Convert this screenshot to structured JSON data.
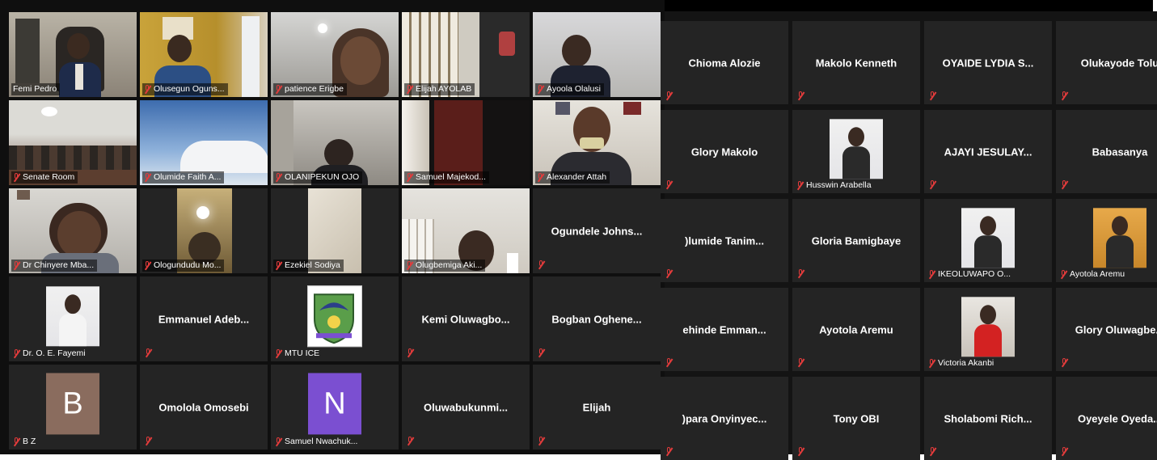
{
  "left_grid": {
    "tiles": [
      {
        "name": "Femi Pedro",
        "kind": "video",
        "active": true
      },
      {
        "name": "Olusegun Oguns...",
        "kind": "video"
      },
      {
        "name": "patience Erigbe",
        "kind": "video"
      },
      {
        "name": "Elijah AYOLAB",
        "kind": "video"
      },
      {
        "name": "Ayoola Olalusi",
        "kind": "video"
      },
      {
        "name": "Senate Room",
        "kind": "video"
      },
      {
        "name": "Olumide Faith A...",
        "kind": "video"
      },
      {
        "name": "OLANIPEKUN OJO",
        "kind": "video"
      },
      {
        "name": "Samuel Majekod...",
        "kind": "video"
      },
      {
        "name": "Alexander Attah",
        "kind": "video"
      },
      {
        "name": "Dr Chinyere Mba...",
        "kind": "video"
      },
      {
        "name": "Ologundudu Mo...",
        "kind": "video"
      },
      {
        "name": "Ezekiel Sodiya",
        "kind": "video"
      },
      {
        "name": "Olugbemiga Aki...",
        "kind": "video"
      },
      {
        "name": "Ogundele Johns...",
        "kind": "text"
      },
      {
        "name": "Dr. O. E. Fayemi",
        "kind": "photo"
      },
      {
        "name": "Emmanuel Adeb...",
        "kind": "text"
      },
      {
        "name": "MTU ICE",
        "kind": "logo"
      },
      {
        "name": "Kemi Oluwagbo...",
        "kind": "text"
      },
      {
        "name": "Bogban Oghene...",
        "kind": "text"
      },
      {
        "name": "B Z",
        "kind": "avatar",
        "letter": "B",
        "color": "#8a6c5e"
      },
      {
        "name": "Omolola Omosebi",
        "kind": "text"
      },
      {
        "name": "Samuel Nwachuk...",
        "kind": "avatar",
        "letter": "N",
        "color": "#7b4fd1"
      },
      {
        "name": "Oluwabukunmi...",
        "kind": "text"
      },
      {
        "name": "Elijah",
        "kind": "text"
      }
    ]
  },
  "right_grid": {
    "tiles": [
      {
        "name": "Chioma Alozie",
        "kind": "text"
      },
      {
        "name": "Makolo Kenneth",
        "kind": "text"
      },
      {
        "name": "OYAIDE LYDIA S...",
        "kind": "text"
      },
      {
        "name": "Olukayode Tolu",
        "kind": "text"
      },
      {
        "name": "Glory Makolo",
        "kind": "text"
      },
      {
        "name": "Husswin Arabella",
        "kind": "photo"
      },
      {
        "name": "AJAYI JESULAY...",
        "kind": "text"
      },
      {
        "name": "Babasanya",
        "kind": "text"
      },
      {
        "name": "Olumide Tanim...",
        "display": ")lumide Tanim...",
        "kind": "text"
      },
      {
        "name": "Gloria Bamigbaye",
        "kind": "text"
      },
      {
        "name": "IKEOLUWAPO O...",
        "kind": "photo"
      },
      {
        "name": "Ayotola Aremu",
        "kind": "photo"
      },
      {
        "name": "Kehinde Emman...",
        "display": "ehinde Emman...",
        "kind": "text"
      },
      {
        "name": "Ayotola Aremu",
        "kind": "text"
      },
      {
        "name": "Victoria Akanbi",
        "kind": "photo"
      },
      {
        "name": "Glory Oluwagbe...",
        "kind": "text"
      },
      {
        "name": "Opara Onyinyec...",
        "display": ")para Onyinyec...",
        "kind": "text"
      },
      {
        "name": "Tony OBI",
        "kind": "text"
      },
      {
        "name": "Sholabomi Rich...",
        "kind": "text"
      },
      {
        "name": "Oyeyele Oyeda...",
        "kind": "text"
      }
    ]
  },
  "colors": {
    "tile_bg": "#242424",
    "active_border": "#c7d24a",
    "muted_mic": "#e23b3b"
  }
}
